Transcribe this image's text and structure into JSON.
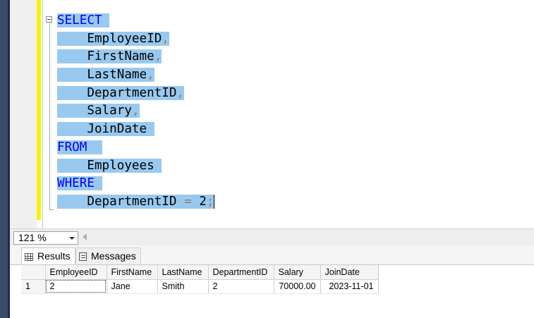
{
  "editor": {
    "lines": [
      {
        "parts": [
          {
            "t": "SELECT",
            "c": "kw"
          },
          {
            "t": " ",
            "c": "id"
          }
        ]
      },
      {
        "parts": [
          {
            "t": "    EmployeeID",
            "c": "id"
          },
          {
            "t": ",",
            "c": "punc"
          }
        ]
      },
      {
        "parts": [
          {
            "t": "    FirstName",
            "c": "id"
          },
          {
            "t": ",",
            "c": "punc"
          }
        ]
      },
      {
        "parts": [
          {
            "t": "    LastName",
            "c": "id"
          },
          {
            "t": ",",
            "c": "punc"
          }
        ]
      },
      {
        "parts": [
          {
            "t": "    DepartmentID",
            "c": "id"
          },
          {
            "t": ",",
            "c": "punc"
          }
        ]
      },
      {
        "parts": [
          {
            "t": "    Salary",
            "c": "id"
          },
          {
            "t": ",",
            "c": "punc"
          }
        ]
      },
      {
        "parts": [
          {
            "t": "    JoinDate ",
            "c": "id"
          }
        ]
      },
      {
        "parts": [
          {
            "t": "FROM",
            "c": "kw"
          },
          {
            "t": "  ",
            "c": "id"
          }
        ]
      },
      {
        "parts": [
          {
            "t": "    Employees ",
            "c": "id"
          }
        ]
      },
      {
        "parts": [
          {
            "t": "WHERE",
            "c": "kw"
          },
          {
            "t": " ",
            "c": "id"
          }
        ]
      },
      {
        "parts": [
          {
            "t": "    DepartmentID ",
            "c": "id"
          },
          {
            "t": "=",
            "c": "punc"
          },
          {
            "t": " 2",
            "c": "id"
          },
          {
            "t": ";",
            "c": "punc"
          }
        ]
      }
    ]
  },
  "statusbar": {
    "zoom": "121 %"
  },
  "tabs": {
    "results": "Results",
    "messages": "Messages"
  },
  "grid": {
    "columns": [
      "EmployeeID",
      "FirstName",
      "LastName",
      "DepartmentID",
      "Salary",
      "JoinDate"
    ],
    "rows": [
      {
        "num": "1",
        "cells": [
          "2",
          "Jane",
          "Smith",
          "2",
          "70000.00",
          "2023-11-01"
        ]
      }
    ]
  },
  "colors": {
    "selection": "#99c9ef",
    "keyword": "#0000ff",
    "change_bar": "#f5f500"
  }
}
